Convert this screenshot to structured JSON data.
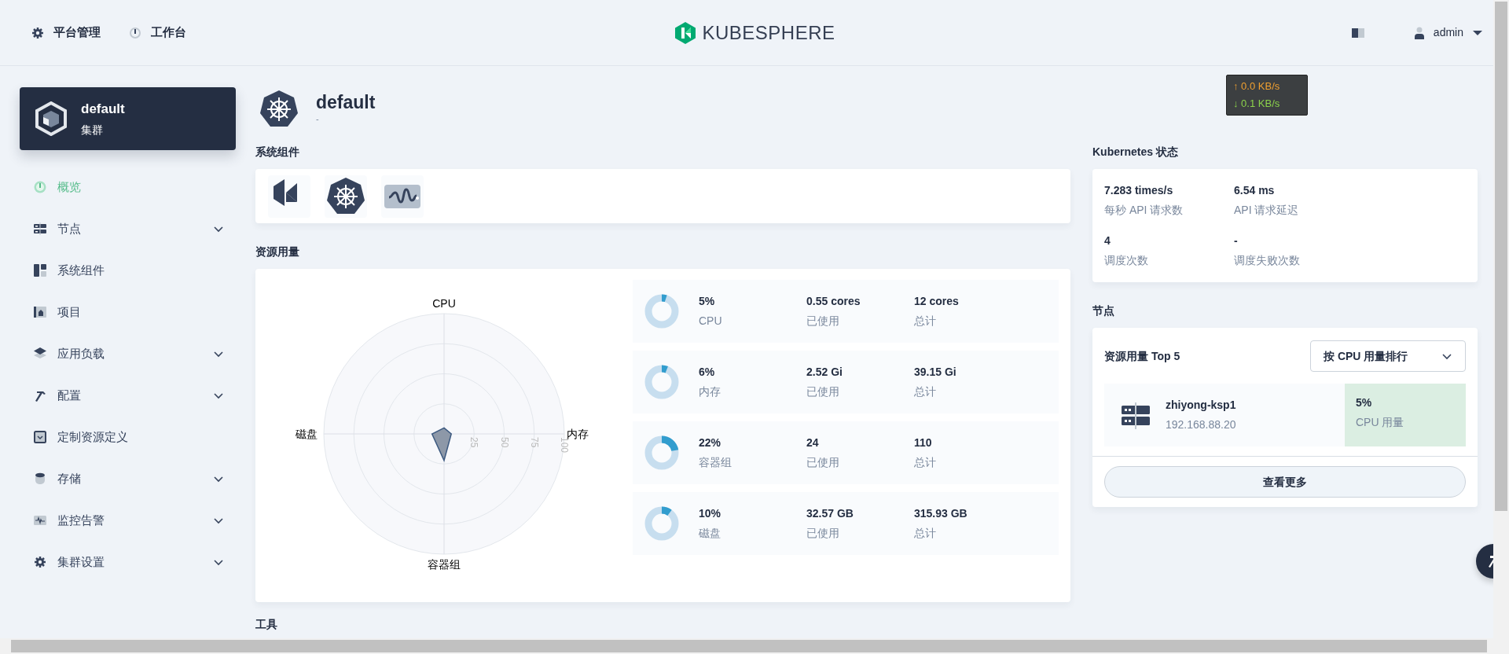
{
  "topbar": {
    "nav": [
      {
        "label": "平台管理"
      },
      {
        "label": "工作台"
      }
    ],
    "logo": "KUBESPHERE",
    "user": "admin"
  },
  "net_speed": {
    "up": "↑ 0.0 KB/s",
    "down": "↓ 0.1 KB/s"
  },
  "sidebar": {
    "cluster": {
      "name": "default",
      "type": "集群"
    },
    "items": [
      {
        "label": "概览",
        "selected": true,
        "expandable": false
      },
      {
        "label": "节点",
        "selected": false,
        "expandable": true
      },
      {
        "label": "系统组件",
        "selected": false,
        "expandable": false
      },
      {
        "label": "项目",
        "selected": false,
        "expandable": false
      },
      {
        "label": "应用负载",
        "selected": false,
        "expandable": true
      },
      {
        "label": "配置",
        "selected": false,
        "expandable": true
      },
      {
        "label": "定制资源定义",
        "selected": false,
        "expandable": false
      },
      {
        "label": "存储",
        "selected": false,
        "expandable": true
      },
      {
        "label": "监控告警",
        "selected": false,
        "expandable": true
      },
      {
        "label": "集群设置",
        "selected": false,
        "expandable": true
      }
    ]
  },
  "header": {
    "title": "default",
    "description": "-"
  },
  "system_components": {
    "title": "系统组件"
  },
  "resource_usage": {
    "title": "资源用量",
    "radar": {
      "axes": [
        "CPU",
        "内存",
        "容器组",
        "磁盘"
      ],
      "ticks": [
        "25",
        "50",
        "75",
        "100"
      ]
    },
    "items": [
      {
        "percent": "5%",
        "label": "CPU",
        "level": 0.05,
        "used": "0.55 cores",
        "used_label": "已使用",
        "total": "12 cores",
        "total_label": "总计"
      },
      {
        "percent": "6%",
        "label": "内存",
        "level": 0.06,
        "used": "2.52 Gi",
        "used_label": "已使用",
        "total": "39.15 Gi",
        "total_label": "总计"
      },
      {
        "percent": "22%",
        "label": "容器组",
        "level": 0.22,
        "used": "24",
        "used_label": "已使用",
        "total": "110",
        "total_label": "总计"
      },
      {
        "percent": "10%",
        "label": "磁盘",
        "level": 0.1,
        "used": "32.57 GB",
        "used_label": "已使用",
        "total": "315.93 GB",
        "total_label": "总计"
      }
    ]
  },
  "tools": {
    "title": "工具"
  },
  "k8s_status": {
    "title": "Kubernetes 状态",
    "metrics": [
      {
        "value": "7.283 times/s",
        "label": "每秒 API 请求数"
      },
      {
        "value": "6.54 ms",
        "label": "API 请求延迟"
      },
      {
        "value": "4",
        "label": "调度次数"
      },
      {
        "value": "-",
        "label": "调度失败次数"
      }
    ]
  },
  "nodes": {
    "title": "节点",
    "subtitle": "资源用量 Top 5",
    "sort": "按 CPU 用量排行",
    "rows": [
      {
        "name": "zhiyong-ksp1",
        "ip": "192.168.88.20",
        "value": "5%",
        "metric": "CPU 用量"
      }
    ],
    "more": "查看更多"
  }
}
